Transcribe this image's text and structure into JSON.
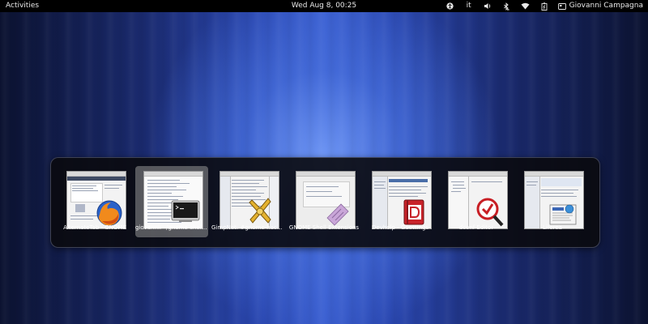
{
  "topbar": {
    "activities": "Activities",
    "clock": "Wed Aug  8, 00:25",
    "keyboard_layout": "it",
    "user_name": "Giovanni Campagna",
    "icons": [
      "accessibility-icon",
      "volume-icon",
      "bluetooth-icon",
      "wifi-icon",
      "battery-icon",
      "user-icon"
    ]
  },
  "switcher": {
    "selected_index": 1,
    "apps": [
      {
        "title": "AlternateTab - GNOME Shell Extensions - Mozilla Firefox",
        "display": "AlternateTab - GNOME",
        "icon": "firefox-icon"
      },
      {
        "title": "giovanni:~/gnome-shell-extensions",
        "display": "giovanni:~/gnome-shell-extensions",
        "icon": "terminal-icon"
      },
      {
        "title": "GimpNet: #gnome-hackers",
        "display": "GimpNet: #gnome-hackers",
        "icon": "xchat-icon"
      },
      {
        "title": "GNOME Shell Extensions",
        "display": "GNOME Shell Extensions",
        "icon": "extensions-icon"
      },
      {
        "title": "Devhelp - GSettings",
        "display": "Devhelp - GSettings",
        "icon": "devhelp-icon"
      },
      {
        "title": "dconf Editor",
        "display": "dconf Editor",
        "icon": "dconf-icon"
      },
      {
        "title": "Liferea",
        "display": "Liferea",
        "icon": "liferea-icon"
      }
    ]
  },
  "colors": {
    "topbar": "#000000",
    "switcher_bg": "#0a0a0e",
    "selected": "#969696",
    "wallpaper_center": "#5a7ee8"
  }
}
